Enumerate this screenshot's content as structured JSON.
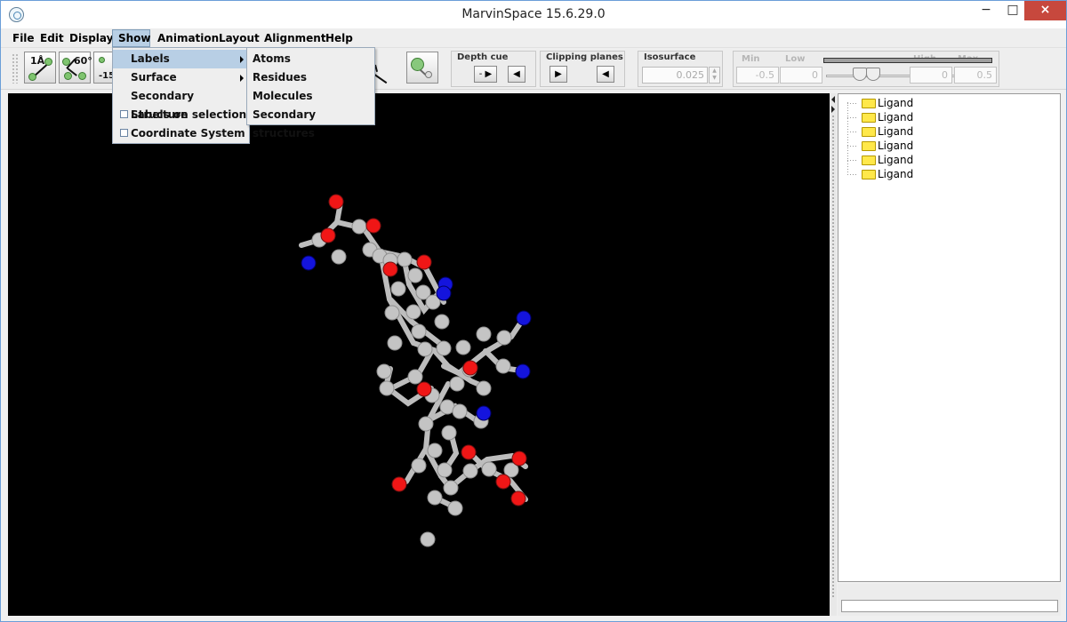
{
  "window": {
    "title": "MarvinSpace 15.6.29.0",
    "min_icon": "minimize-icon",
    "max_icon": "maximize-icon",
    "close_icon": "close-icon",
    "min_glyph": "−",
    "max_glyph": "□",
    "close_glyph": "×"
  },
  "menubar": {
    "items": [
      {
        "label": "File"
      },
      {
        "label": "Edit"
      },
      {
        "label": "Display"
      },
      {
        "label": "Show"
      },
      {
        "label": "Animation"
      },
      {
        "label": "Layout"
      },
      {
        "label": "Alignment"
      },
      {
        "label": "Help"
      }
    ]
  },
  "toolbar": {
    "distance_label": "1Å",
    "angle_label": "60°",
    "dihedral_label": "-15",
    "depth_cue": {
      "title": "Depth cue",
      "left_symbol": "-",
      "right_symbol": "◀"
    },
    "clipping": {
      "title": "Clipping planes"
    },
    "isosurface": {
      "title": "Isosurface",
      "value": "0.025"
    },
    "range": {
      "min_label": "Min",
      "low_label": "Low",
      "high_label": "High",
      "max_label": "Max",
      "min_value": "-0.5",
      "low_value": "0",
      "high_value": "0",
      "max_value": "0.5"
    }
  },
  "show_menu": {
    "items": [
      {
        "label": "Labels"
      },
      {
        "label": "Surface"
      },
      {
        "label": "Secondary Structure"
      },
      {
        "label": "Labels on selection"
      },
      {
        "label": "Coordinate System"
      }
    ]
  },
  "labels_submenu": {
    "items": [
      {
        "label": "Atoms"
      },
      {
        "label": "Residues"
      },
      {
        "label": "Molecules"
      },
      {
        "label": "Secondary structures"
      }
    ]
  },
  "tree": {
    "items": [
      {
        "label": "Ligand"
      },
      {
        "label": "Ligand"
      },
      {
        "label": "Ligand"
      },
      {
        "label": "Ligand"
      },
      {
        "label": "Ligand"
      },
      {
        "label": "Ligand"
      }
    ]
  },
  "colors": {
    "carbon": "#c7c7c7",
    "oxygen": "#ee1111",
    "nitrogen": "#1111dd",
    "menu_highlight": "#b8cfe5"
  }
}
